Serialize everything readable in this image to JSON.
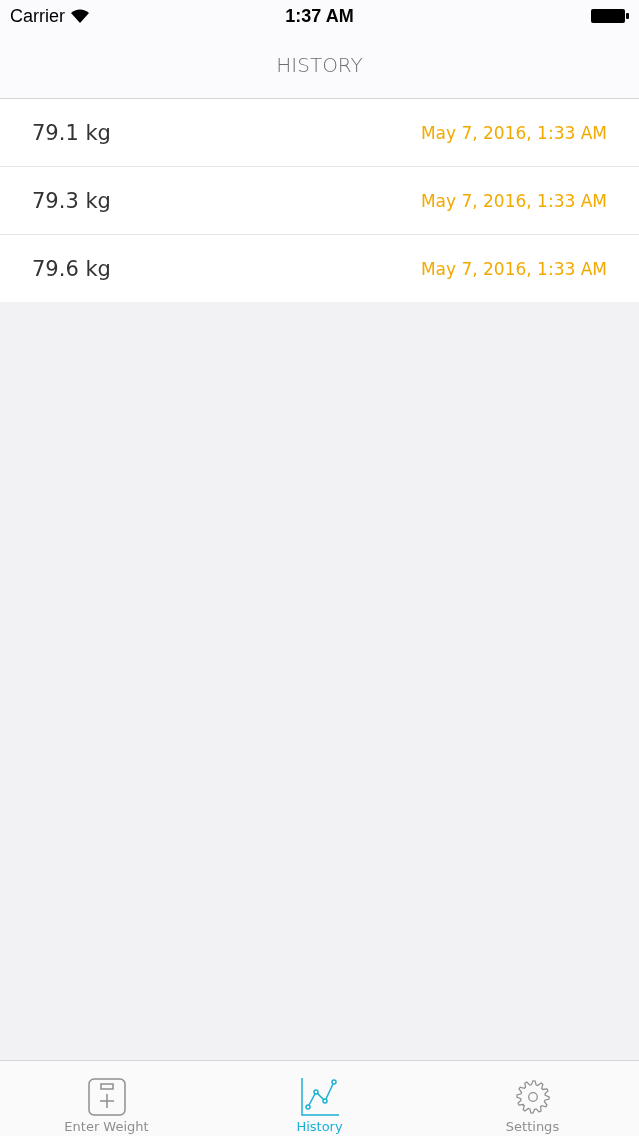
{
  "status_bar": {
    "carrier": "Carrier",
    "time": "1:37 AM"
  },
  "nav": {
    "title": "HISTORY"
  },
  "entries": [
    {
      "weight": "79.1 kg",
      "date": "May 7, 2016, 1:33 AM"
    },
    {
      "weight": "79.3 kg",
      "date": "May 7, 2016, 1:33 AM"
    },
    {
      "weight": "79.6 kg",
      "date": "May 7, 2016, 1:33 AM"
    }
  ],
  "tabs": [
    {
      "label": "Enter Weight",
      "selected": false
    },
    {
      "label": "History",
      "selected": true
    },
    {
      "label": "Settings",
      "selected": false
    }
  ]
}
